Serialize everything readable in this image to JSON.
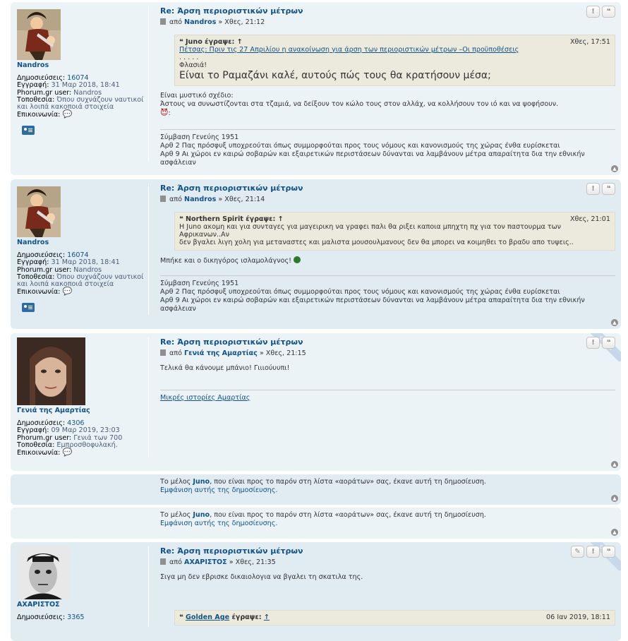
{
  "posts": [
    {
      "title": "Re: Άρση περιοριστικών μέτρων",
      "by": "από",
      "author": "Nandros",
      "time": "» Χθες, 21:12",
      "profile": {
        "name": "Nandros",
        "posts_label": "Δημοσιεύσεις:",
        "posts": "16074",
        "joined_label": "Εγγραφή:",
        "joined": "31 Μαρ 2018, 18:41",
        "phorum_label": "Phorum.gr user:",
        "phorum": "Nandros",
        "loc_label": "Τοποθεσία:",
        "loc": "Όπου συχνάζουν ναυτικοί",
        "loc2": "και λοιπά κακοποιά στοιχεία",
        "contact_label": "Επικοινωνία:"
      },
      "quote": {
        "author": "Juno",
        "wrote": "έγραψε:",
        "arrow": "↑",
        "time": "Χθες, 17:51",
        "link": "Πέτσας: Πριν τις 27 Απριλίου η ανακοίνωση για άρση των περιοριστικών μέτρων –Οι προϋποθέσεις",
        "dots": ". . . . .",
        "line1": "Φλασιά!",
        "big": "Είναι το Ραμαζάνι καλέ, αυτούς πώς τους θα κρατήσουν μέσα;"
      },
      "text1": "Είναι μυστικό σχέδιο:",
      "text2": "Άστους να συνωστίζονται στα τζαμιά, να δείξουν τον κώλο τους στον αλλάχ, να κολλήσουν τον ιό και να ψοφήσουν.",
      "text3": ":",
      "sig": [
        "Σύμβαση Γενεύης 1951",
        "Αρθ 2 Πας πρόσφυξ υποχρεούται όπως συμμορφούται προς τους νόμους και κανονισμούς της χώρας ένθα ευρίσκεται",
        "Αρθ 9 Αι χώροι εν καιρώ σοβαρών και εξαιρετικών περιστάσεων δύνανται να λαμβάνουν μέτρα απαραίτητα δια την εθνικήν ασφάλειαν"
      ]
    },
    {
      "title": "Re: Άρση περιοριστικών μέτρων",
      "by": "από",
      "author": "Nandros",
      "time": "» Χθες, 21:14",
      "profile": {
        "name": "Nandros",
        "posts_label": "Δημοσιεύσεις:",
        "posts": "16074",
        "joined_label": "Εγγραφή:",
        "joined": "31 Μαρ 2018, 18:41",
        "phorum_label": "Phorum.gr user:",
        "phorum": "Nandros",
        "loc_label": "Τοποθεσία:",
        "loc": "Όπου συχνάζουν ναυτικοί",
        "loc2": "και λοιπά κακοποιά στοιχεία",
        "contact_label": "Επικοινωνία:"
      },
      "quote": {
        "author": "Northern Spirit",
        "wrote": "έγραψε:",
        "arrow": "↑",
        "time": "Χθες, 21:01",
        "line1": "Η Juno ακομη και για συνταγες για μαγειρικη να γραφει παλι θα ριξει καποια μπηχτη πχ για τον παστουρμα των Αφρικανων..Αν",
        "line2": "δεν βγαλει λιγη χολη για μεταναστες και μαλιστα μουσουλμανους δεν θα μπορει να κοιμηθει το βραδυ απο τυψεις.."
      },
      "text1": "Μπήκε και ο δικηγόρος ισλαμολάγνος!",
      "sig": [
        "Σύμβαση Γενεύης 1951",
        "Αρθ 2 Πας πρόσφυξ υποχρεούται όπως συμμορφούται προς τους νόμους και κανονισμούς της χώρας ένθα ευρίσκεται",
        "Αρθ 9 Αι χώροι εν καιρώ σοβαρών και εξαιρετικών περιστάσεων δύνανται να λαμβάνουν μέτρα απαραίτητα δια την εθνικήν ασφάλειαν"
      ]
    },
    {
      "title": "Re: Άρση περιοριστικών μέτρων",
      "by": "από",
      "author": "Γενιά της Αμαρτίας",
      "time": "» Χθες, 21:15",
      "online": "ONLINE",
      "profile": {
        "name": "Γενιά της Αμαρτίας",
        "posts_label": "Δημοσιεύσεις:",
        "posts": "4306",
        "joined_label": "Εγγραφή:",
        "joined": "09 Μαρ 2019, 23:03",
        "phorum_label": "Phorum.gr user:",
        "phorum": "Γενιά των 700",
        "loc_label": "Τοποθεσία:",
        "loc": "Εμπροσθοφυλακή.",
        "contact_label": "Επικοινωνία:"
      },
      "text1": "Τελικά θα κάνουμε μπάνιο! Γιιιούυυπι!",
      "sig_link": "Μικρές ιστορίες Αμαρτίας"
    },
    {
      "title": "Re: Άρση περιοριστικών μέτρων",
      "by": "από",
      "author": "ΑΧΑΡΙΣΤΟΣ",
      "time": "» Χθες, 21:35",
      "online": "ONLINE",
      "profile": {
        "name": "ΑΧΑΡΙΣΤΟΣ",
        "posts_label": "Δημοσιεύσεις:",
        "posts": "3365"
      },
      "text1": "Σιγα μη δεν εβρισκε δικαιολογια να βγαλει τη σκατιλα της.",
      "quote": {
        "author": "Golden Age",
        "wrote": "έγραψε:",
        "arrow": "↑",
        "time": "06 Ιαν 2019, 18:11"
      }
    }
  ],
  "ignored": {
    "prefix": "Το μέλος",
    "user": "Juno",
    "suffix": ", που είναι προς το παρόν στη λίστα «αοράτων» σας, έκανε αυτή τη δημοσίευση.",
    "show": "Εμφάνιση αυτής της δημοσίευσης."
  },
  "icons": {
    "report": "!",
    "quote": "❝",
    "edit": "✎",
    "top": "▲",
    "chat": "💬"
  }
}
